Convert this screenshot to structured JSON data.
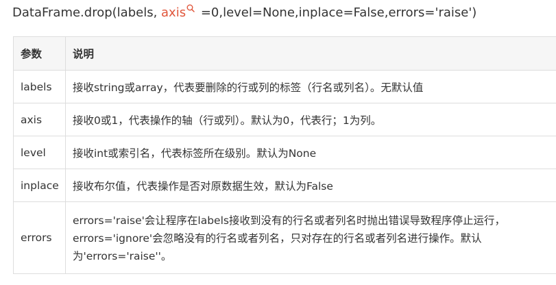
{
  "signature": {
    "prefix": "DataFrame.drop(labels, ",
    "highlight": "axis",
    "suffix": " =0,level=None,inplace=False,errors='raise')",
    "highlight_color": "#e0553a",
    "icon": "search-icon"
  },
  "table": {
    "headers": [
      "参数",
      "说明"
    ],
    "rows": [
      {
        "param": "labels",
        "desc": [
          "接收string或array，代表要删除的行或列的标签（行名或列名）。无默认值"
        ]
      },
      {
        "param": "axis",
        "desc": [
          "接收0或1，代表操作的轴（行或列）。默认为0，代表行；1为列。"
        ]
      },
      {
        "param": "level",
        "desc": [
          "接收int或索引名，代表标签所在级别。默认为None"
        ]
      },
      {
        "param": "inplace",
        "desc": [
          "接收布尔值，代表操作是否对原数据生效，默认为False"
        ]
      },
      {
        "param": "errors",
        "desc": [
          "errors='raise'会让程序在labels接收到没有的行名或者列名时抛出错误导致程序停止运行，",
          "errors='ignore'会忽略没有的行名或者列名，只对存在的行名或者列名进行操作。默认",
          "为'errors='raise''。"
        ]
      }
    ]
  },
  "colors": {
    "text": "#333333",
    "header_bg": "#f6f6f6",
    "border": "#dddddd"
  }
}
